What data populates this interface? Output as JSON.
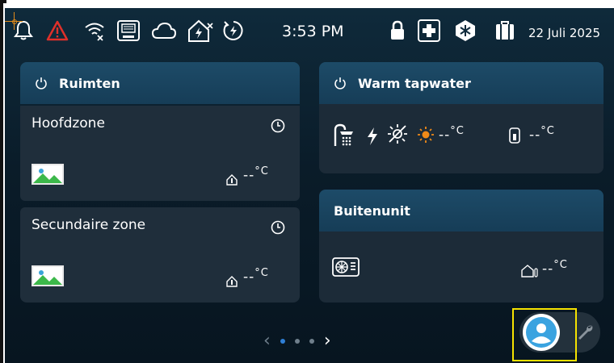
{
  "status_bar": {
    "time": "3:53 PM",
    "date": "22 Juli 2025",
    "icons": [
      "bell-icon",
      "warning-icon",
      "wifi-off-icon",
      "network-module-icon",
      "cloud-icon",
      "home-energy-icon",
      "power-boost-icon",
      "lock-icon",
      "medical-icon",
      "snowflake-icon",
      "luggage-icon"
    ]
  },
  "rooms": {
    "title": "Ruimten",
    "zones": [
      {
        "name": "Hoofdzone",
        "temp": "--",
        "unit": "°C"
      },
      {
        "name": "Secundaire zone",
        "temp": "--",
        "unit": "°C"
      }
    ]
  },
  "hot_water": {
    "title": "Warm tapwater",
    "temp1": "--",
    "temp2": "--",
    "unit": "°C"
  },
  "outdoor_unit": {
    "title": "Buitenunit",
    "temp": "--",
    "unit": "°C"
  },
  "pager": {
    "prev": "‹",
    "next": "›",
    "pages": 3,
    "active": 1
  },
  "colors": {
    "accent": "#2f7fd6",
    "warning": "#e0302a",
    "sun": "#f08a18",
    "highlight": "#f5e200"
  }
}
